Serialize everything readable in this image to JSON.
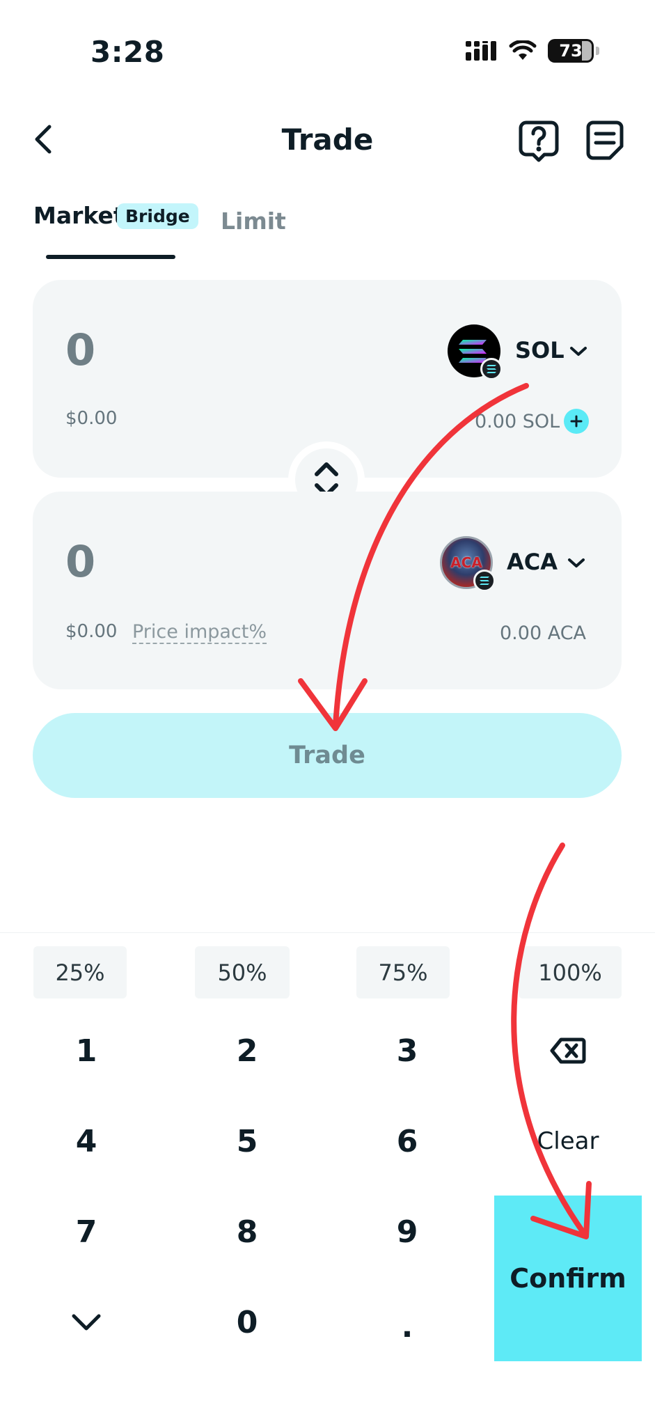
{
  "status_bar": {
    "time": "3:28",
    "battery": "73"
  },
  "header": {
    "title": "Trade"
  },
  "tabs": {
    "market": "Market",
    "badge": "Bridge",
    "limit": "Limit"
  },
  "from_card": {
    "amount": "0",
    "usd": "$0.00",
    "token": "SOL",
    "balance": "0.00 SOL"
  },
  "to_card": {
    "amount": "0",
    "usd": "$0.00",
    "price_impact": "Price impact%",
    "token": "ACA",
    "balance": "0.00 ACA",
    "logo_text": "ACA"
  },
  "trade_button": "Trade",
  "keypad": {
    "percents": [
      "25%",
      "50%",
      "75%",
      "100%"
    ],
    "keys": [
      "1",
      "2",
      "3",
      "4",
      "5",
      "6",
      "7",
      "8",
      "9",
      "0",
      "."
    ],
    "clear": "Clear",
    "confirm": "Confirm"
  },
  "colors": {
    "accent": "#5eeaf6",
    "trade_disabled": "#c3f5f9",
    "annotation_red": "#f0343a",
    "card_bg": "#f3f6f7"
  }
}
